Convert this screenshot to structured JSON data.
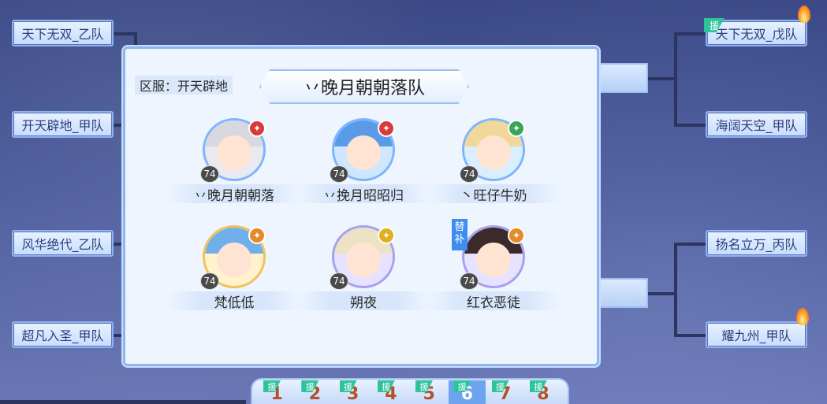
{
  "left_teams": [
    "天下无双_乙队",
    "开天辟地_甲队",
    "风华绝代_乙队",
    "超凡入圣_甲队"
  ],
  "right_teams": [
    {
      "name": "天下无双_戊队",
      "tag": "援",
      "fire": true
    },
    {
      "name": "海阔天空_甲队",
      "tag": "",
      "fire": false
    },
    {
      "name": "扬名立万_丙队",
      "tag": "",
      "fire": false
    },
    {
      "name": "耀九州_甲队",
      "tag": "",
      "fire": true
    }
  ],
  "panel": {
    "server": "区服：开天辟地",
    "title": "丷晚月朝朝落队",
    "members": [
      {
        "name": "丷晚月朝朝落",
        "level": "74",
        "element": "red",
        "substitute": false
      },
      {
        "name": "丷挽月昭昭归",
        "level": "74",
        "element": "red",
        "substitute": false
      },
      {
        "name": "丶旺仔牛奶",
        "level": "74",
        "element": "green",
        "substitute": false
      },
      {
        "name": "梵低低",
        "level": "74",
        "element": "orange",
        "substitute": false
      },
      {
        "name": "朔夜",
        "level": "74",
        "element": "yellow",
        "substitute": false
      },
      {
        "name": "红衣恶徒",
        "level": "74",
        "element": "orange",
        "substitute": true,
        "substitute_label": "替补"
      }
    ]
  },
  "tabs": {
    "tag": "援",
    "items": [
      "1",
      "2",
      "3",
      "4",
      "5",
      "6",
      "7",
      "8"
    ],
    "active_index": 5
  },
  "colors": {
    "red": "#d83a3a",
    "green": "#3aa55a",
    "orange": "#e48a2a",
    "yellow": "#e0b020"
  }
}
